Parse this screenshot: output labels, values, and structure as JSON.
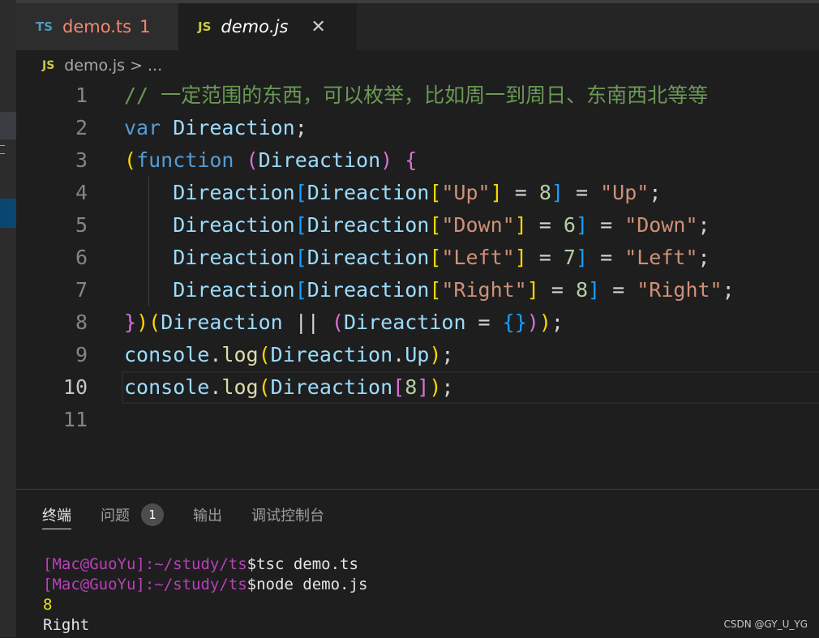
{
  "tabs": [
    {
      "icon": "TS",
      "name": "demo.ts",
      "problems": "1"
    },
    {
      "icon": "JS",
      "name": "demo.js",
      "close": "✕"
    }
  ],
  "breadcrumb": {
    "icon": "JS",
    "file": "demo.js",
    "sep": ">",
    "rest": "..."
  },
  "editor": {
    "active_line": "10",
    "lines": [
      {
        "n": "1",
        "tokens": [
          {
            "t": "// 一定范围的东西，可以枚举，比如周一到周日、东南西北等等",
            "c": "c"
          }
        ]
      },
      {
        "n": "2",
        "tokens": [
          {
            "t": "var",
            "c": "k"
          },
          {
            "t": " ",
            "c": "p"
          },
          {
            "t": "Direaction",
            "c": "v"
          },
          {
            "t": ";",
            "c": "p"
          }
        ]
      },
      {
        "n": "3",
        "tokens": [
          {
            "t": "(",
            "c": "b1"
          },
          {
            "t": "function",
            "c": "k"
          },
          {
            "t": " ",
            "c": "p"
          },
          {
            "t": "(",
            "c": "b2"
          },
          {
            "t": "Direaction",
            "c": "v"
          },
          {
            "t": ")",
            "c": "b2"
          },
          {
            "t": " ",
            "c": "p"
          },
          {
            "t": "{",
            "c": "b2"
          }
        ]
      },
      {
        "n": "4",
        "tokens": [
          {
            "t": "    ",
            "c": "p"
          },
          {
            "t": "Direaction",
            "c": "v"
          },
          {
            "t": "[",
            "c": "b3"
          },
          {
            "t": "Direaction",
            "c": "v"
          },
          {
            "t": "[",
            "c": "b1"
          },
          {
            "t": "\"Up\"",
            "c": "s"
          },
          {
            "t": "]",
            "c": "b1"
          },
          {
            "t": " = ",
            "c": "p"
          },
          {
            "t": "8",
            "c": "n"
          },
          {
            "t": "]",
            "c": "b3"
          },
          {
            "t": " = ",
            "c": "p"
          },
          {
            "t": "\"Up\"",
            "c": "s"
          },
          {
            "t": ";",
            "c": "p"
          }
        ]
      },
      {
        "n": "5",
        "tokens": [
          {
            "t": "    ",
            "c": "p"
          },
          {
            "t": "Direaction",
            "c": "v"
          },
          {
            "t": "[",
            "c": "b3"
          },
          {
            "t": "Direaction",
            "c": "v"
          },
          {
            "t": "[",
            "c": "b1"
          },
          {
            "t": "\"Down\"",
            "c": "s"
          },
          {
            "t": "]",
            "c": "b1"
          },
          {
            "t": " = ",
            "c": "p"
          },
          {
            "t": "6",
            "c": "n"
          },
          {
            "t": "]",
            "c": "b3"
          },
          {
            "t": " = ",
            "c": "p"
          },
          {
            "t": "\"Down\"",
            "c": "s"
          },
          {
            "t": ";",
            "c": "p"
          }
        ]
      },
      {
        "n": "6",
        "tokens": [
          {
            "t": "    ",
            "c": "p"
          },
          {
            "t": "Direaction",
            "c": "v"
          },
          {
            "t": "[",
            "c": "b3"
          },
          {
            "t": "Direaction",
            "c": "v"
          },
          {
            "t": "[",
            "c": "b1"
          },
          {
            "t": "\"Left\"",
            "c": "s"
          },
          {
            "t": "]",
            "c": "b1"
          },
          {
            "t": " = ",
            "c": "p"
          },
          {
            "t": "7",
            "c": "n"
          },
          {
            "t": "]",
            "c": "b3"
          },
          {
            "t": " = ",
            "c": "p"
          },
          {
            "t": "\"Left\"",
            "c": "s"
          },
          {
            "t": ";",
            "c": "p"
          }
        ]
      },
      {
        "n": "7",
        "tokens": [
          {
            "t": "    ",
            "c": "p"
          },
          {
            "t": "Direaction",
            "c": "v"
          },
          {
            "t": "[",
            "c": "b3"
          },
          {
            "t": "Direaction",
            "c": "v"
          },
          {
            "t": "[",
            "c": "b1"
          },
          {
            "t": "\"Right\"",
            "c": "s"
          },
          {
            "t": "]",
            "c": "b1"
          },
          {
            "t": " = ",
            "c": "p"
          },
          {
            "t": "8",
            "c": "n"
          },
          {
            "t": "]",
            "c": "b3"
          },
          {
            "t": " = ",
            "c": "p"
          },
          {
            "t": "\"Right\"",
            "c": "s"
          },
          {
            "t": ";",
            "c": "p"
          }
        ]
      },
      {
        "n": "8",
        "tokens": [
          {
            "t": "}",
            "c": "b2"
          },
          {
            "t": ")",
            "c": "b1"
          },
          {
            "t": "(",
            "c": "b1"
          },
          {
            "t": "Direaction",
            "c": "v"
          },
          {
            "t": " || ",
            "c": "p"
          },
          {
            "t": "(",
            "c": "b2"
          },
          {
            "t": "Direaction",
            "c": "v"
          },
          {
            "t": " = ",
            "c": "p"
          },
          {
            "t": "{}",
            "c": "b3"
          },
          {
            "t": ")",
            "c": "b2"
          },
          {
            "t": ")",
            "c": "b1"
          },
          {
            "t": ";",
            "c": "p"
          }
        ]
      },
      {
        "n": "9",
        "tokens": [
          {
            "t": "console",
            "c": "v"
          },
          {
            "t": ".",
            "c": "p"
          },
          {
            "t": "log",
            "c": "f"
          },
          {
            "t": "(",
            "c": "b1"
          },
          {
            "t": "Direaction",
            "c": "v"
          },
          {
            "t": ".",
            "c": "p"
          },
          {
            "t": "Up",
            "c": "v"
          },
          {
            "t": ")",
            "c": "b1"
          },
          {
            "t": ";",
            "c": "p"
          }
        ]
      },
      {
        "n": "10",
        "tokens": [
          {
            "t": "console",
            "c": "v"
          },
          {
            "t": ".",
            "c": "p"
          },
          {
            "t": "log",
            "c": "f"
          },
          {
            "t": "(",
            "c": "b1"
          },
          {
            "t": "Direaction",
            "c": "v"
          },
          {
            "t": "[",
            "c": "b2"
          },
          {
            "t": "8",
            "c": "n"
          },
          {
            "t": "]",
            "c": "b2"
          },
          {
            "t": ")",
            "c": "b1"
          },
          {
            "t": ";",
            "c": "p"
          }
        ]
      },
      {
        "n": "11",
        "tokens": []
      }
    ]
  },
  "panel": {
    "tabs": [
      {
        "label": "终端",
        "active": true
      },
      {
        "label": "问题",
        "badge": "1"
      },
      {
        "label": "输出"
      },
      {
        "label": "调试控制台"
      }
    ],
    "terminal": [
      {
        "prompt": "[Mac@GuoYu]:",
        "dir": "~/study/ts",
        "cmd": "$tsc demo.ts"
      },
      {
        "prompt": "[Mac@GuoYu]:",
        "dir": "~/study/ts",
        "cmd": "$node demo.js"
      },
      {
        "output": "8",
        "yellow": true
      },
      {
        "output": "Right"
      }
    ]
  },
  "watermark": "CSDN @GY_U_YG"
}
